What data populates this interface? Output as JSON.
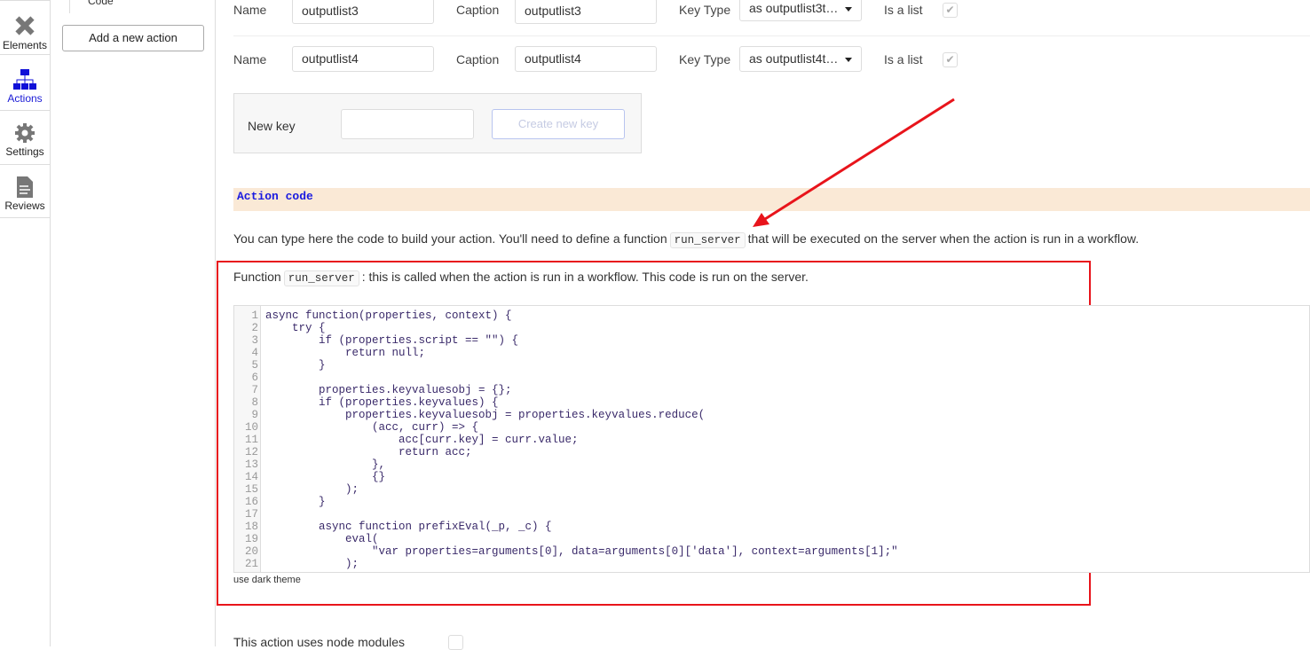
{
  "sidebar": {
    "items": [
      {
        "label": "Elements",
        "icon": "tools-icon"
      },
      {
        "label": "Actions",
        "icon": "sitemap-icon",
        "active": true
      },
      {
        "label": "Settings",
        "icon": "gear-icon"
      },
      {
        "label": "Reviews",
        "icon": "document-icon"
      }
    ]
  },
  "actions_panel": {
    "code_item": "Code",
    "add_button": "Add a new action"
  },
  "keys": [
    {
      "name_label": "Name",
      "name": "outputlist3",
      "caption_label": "Caption",
      "caption": "outputlist3",
      "type_label": "Key Type",
      "type": "as outputlist3t…",
      "list_label": "Is a list",
      "is_list": true
    },
    {
      "name_label": "Name",
      "name": "outputlist4",
      "caption_label": "Caption",
      "caption": "outputlist4",
      "type_label": "Key Type",
      "type": "as outputlist4t…",
      "list_label": "Is a list",
      "is_list": true
    }
  ],
  "new_key": {
    "label": "New key",
    "value": "",
    "button": "Create new key"
  },
  "action_code": {
    "header": "Action code",
    "intro_before": "You can type here the code to build your action. You'll need to define a function",
    "intro_code": "run_server",
    "intro_after": "that will be executed on the server when the action is run in a workflow.",
    "fn_before": "Function",
    "fn_code": "run_server",
    "fn_after": ": this is called when the action is run in a workflow. This code is run on the server.",
    "code_lines": [
      "async function(properties, context) {",
      "    try {",
      "        if (properties.script == \"\") {",
      "            return null;",
      "        }",
      "",
      "        properties.keyvaluesobj = {};",
      "        if (properties.keyvalues) {",
      "            properties.keyvaluesobj = properties.keyvalues.reduce(",
      "                (acc, curr) => {",
      "                    acc[curr.key] = curr.value;",
      "                    return acc;",
      "                },",
      "                {}",
      "            );",
      "        }",
      "",
      "        async function prefixEval(_p, _c) {",
      "            eval(",
      "                \"var properties=arguments[0], data=arguments[0]['data'], context=arguments[1];\"",
      "            );"
    ],
    "dark_theme_label": "use dark theme"
  },
  "node_modules": {
    "label": "This action uses node modules",
    "checked": false
  },
  "colors": {
    "accent": "#1a1ad6",
    "highlight_box": "#e8141b",
    "header_bg": "#fae9d6"
  }
}
